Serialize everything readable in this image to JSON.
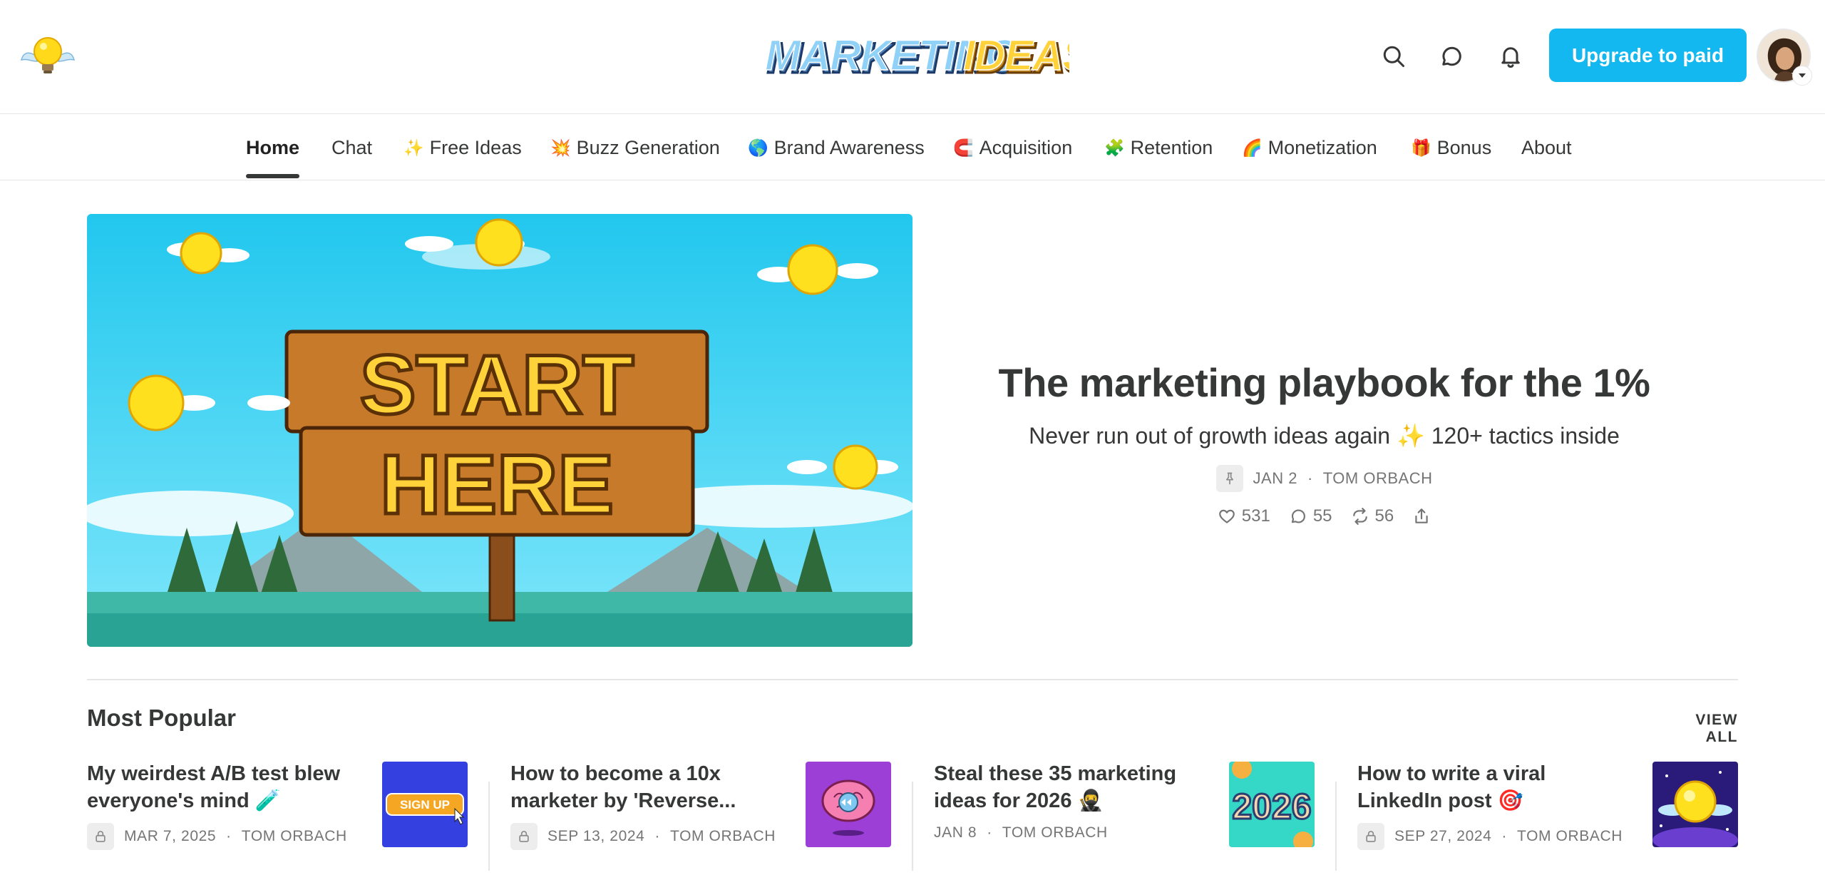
{
  "header": {
    "logo_text": "MARKETINGIDEAS",
    "upgrade_label": "Upgrade to paid",
    "icons": [
      "bulb-wings-icon",
      "search-icon",
      "chat-bubble-icon",
      "bell-icon"
    ]
  },
  "nav": {
    "items": [
      {
        "emoji": "",
        "label": "Home"
      },
      {
        "emoji": "",
        "label": "Chat"
      },
      {
        "emoji": "✨",
        "label": "Free Ideas"
      },
      {
        "emoji": "💥",
        "label": "Buzz Generation"
      },
      {
        "emoji": "🌎",
        "label": "Brand Awareness"
      },
      {
        "emoji": "🧲",
        "label": "Acquisition"
      },
      {
        "emoji": "🧩",
        "label": "Retention"
      },
      {
        "emoji": "🌈",
        "label": "Monetization"
      },
      {
        "emoji": "🎁",
        "label": "Bonus"
      },
      {
        "emoji": "",
        "label": "About"
      }
    ],
    "active": "Home"
  },
  "hero": {
    "image_text_line1": "START",
    "image_text_line2": "HERE",
    "title": "The marketing playbook for the 1%",
    "subtitle": "Never run out of growth ideas again ✨ 120+ tactics inside",
    "date": "JAN 2",
    "author": "TOM ORBACH",
    "likes": "531",
    "comments": "55",
    "restacks": "56"
  },
  "most_popular": {
    "heading": "Most Popular",
    "view_all": "VIEW ALL",
    "posts": [
      {
        "title": "My weirdest A/B test blew everyone's mind 🧪",
        "date": "MAR 7, 2025",
        "author": "TOM ORBACH",
        "locked": true,
        "thumb_text": "SIGN UP"
      },
      {
        "title": "How to become a 10x marketer by 'Reverse...",
        "date": "SEP 13, 2024",
        "author": "TOM ORBACH",
        "locked": true,
        "thumb_text": ""
      },
      {
        "title": "Steal these 35 marketing ideas for 2026 🥷",
        "date": "JAN 8",
        "author": "TOM ORBACH",
        "locked": false,
        "thumb_text": "2026"
      },
      {
        "title": "How to write a viral LinkedIn post 🎯",
        "date": "SEP 27, 2024",
        "author": "TOM ORBACH",
        "locked": true,
        "thumb_text": ""
      }
    ]
  },
  "colors": {
    "accent": "#13b8f0",
    "text": "#363737",
    "meta": "#757575",
    "divider": "#e6e6e6"
  }
}
